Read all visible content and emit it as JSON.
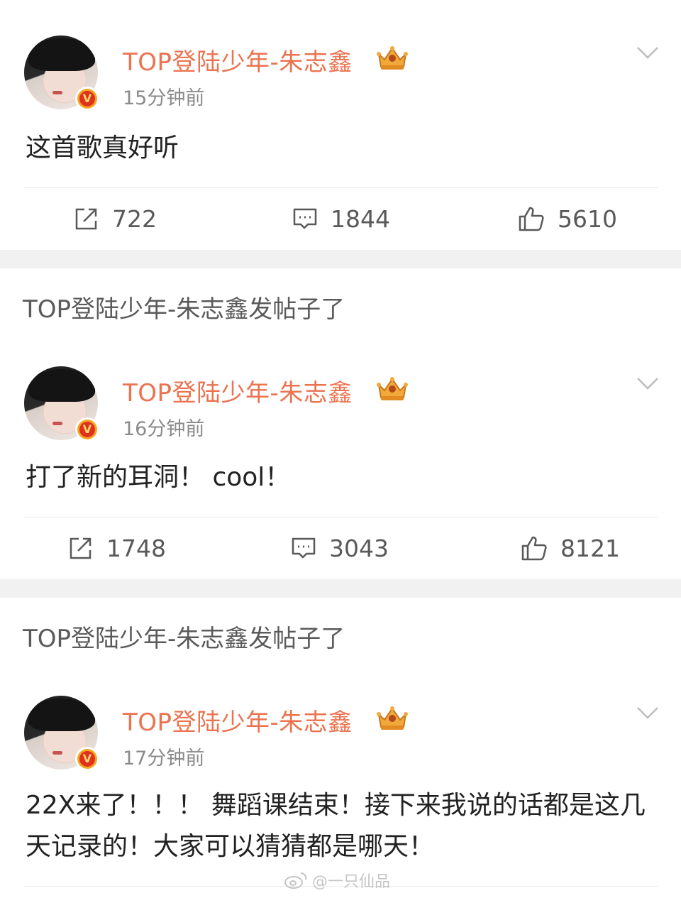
{
  "posts": [
    {
      "username": "TOP登陆少年-朱志鑫",
      "timestamp": "15分钟前",
      "content": "这首歌真好听",
      "repost_count": "722",
      "comment_count": "1844",
      "like_count": "5610"
    },
    {
      "username": "TOP登陆少年-朱志鑫",
      "timestamp": "16分钟前",
      "content": "打了新的耳洞！ cool！",
      "repost_count": "1748",
      "comment_count": "3043",
      "like_count": "8121"
    },
    {
      "username": "TOP登陆少年-朱志鑫",
      "timestamp": "17分钟前",
      "content": "22X来了！！！ 舞蹈课结束！接下来我说的话都是这几天记录的！大家可以猜猜都是哪天！"
    }
  ],
  "banners": [
    {
      "text": "TOP登陆少年-朱志鑫发帖子了"
    },
    {
      "text": "TOP登陆少年-朱志鑫发帖子了"
    }
  ],
  "watermark": {
    "text": "@一只仙品"
  },
  "icons": {
    "verified": "verified-v-icon",
    "crown": "crown-icon",
    "more": "chevron-down-icon",
    "repost": "repost-icon",
    "comment": "comment-icon",
    "like": "thumbs-up-icon"
  },
  "colors": {
    "username": "#eb7350",
    "text": "#222222",
    "meta": "#8a8a8a",
    "separator": "#f1f1f1",
    "verified": "#e0301e"
  }
}
